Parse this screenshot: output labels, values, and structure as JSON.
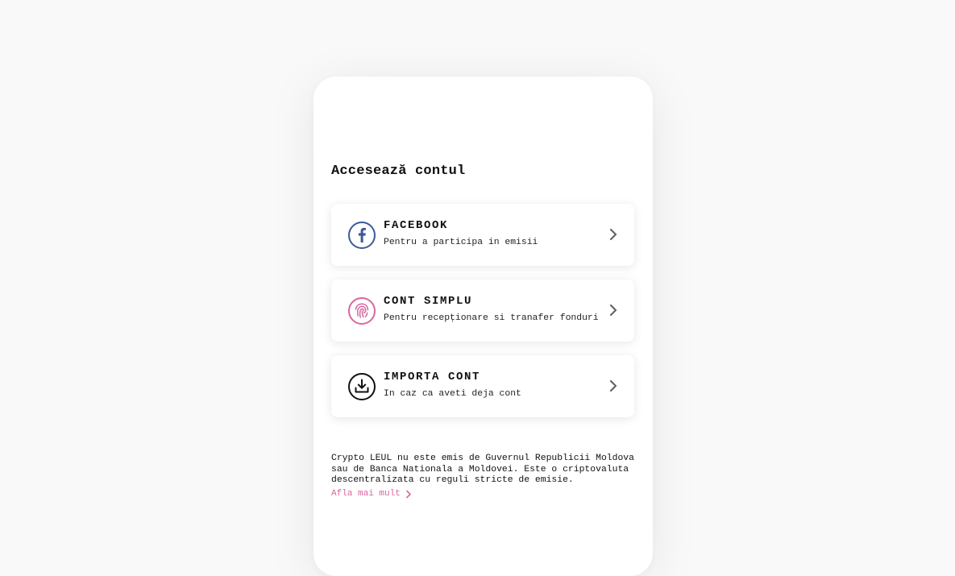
{
  "screen": {
    "title": "Accesează contul",
    "options": [
      {
        "title": "FACEBOOK",
        "subtitle": "Pentru a participa in emisii",
        "icon": "facebook-icon",
        "color": "#3b5998"
      },
      {
        "title": "CONT SIMPLU",
        "subtitle": "Pentru recepționare si tranafer fonduri",
        "icon": "fingerprint-icon",
        "color": "#d9669f"
      },
      {
        "title": "IMPORTA CONT",
        "subtitle": "In caz ca aveti deja cont",
        "icon": "download-icon",
        "color": "#111111"
      }
    ],
    "disclaimer": "Crypto LEUL nu este emis de Guvernul Republicii Moldova sau de Banca Nationala a Moldovei. Este o criptovaluta descentralizata cu reguli stricte de emisie.",
    "learn_more": "Afla mai mult",
    "colors": {
      "accent": "#d9669f",
      "chevron": "#666666",
      "background": "#f9f9fa"
    }
  }
}
